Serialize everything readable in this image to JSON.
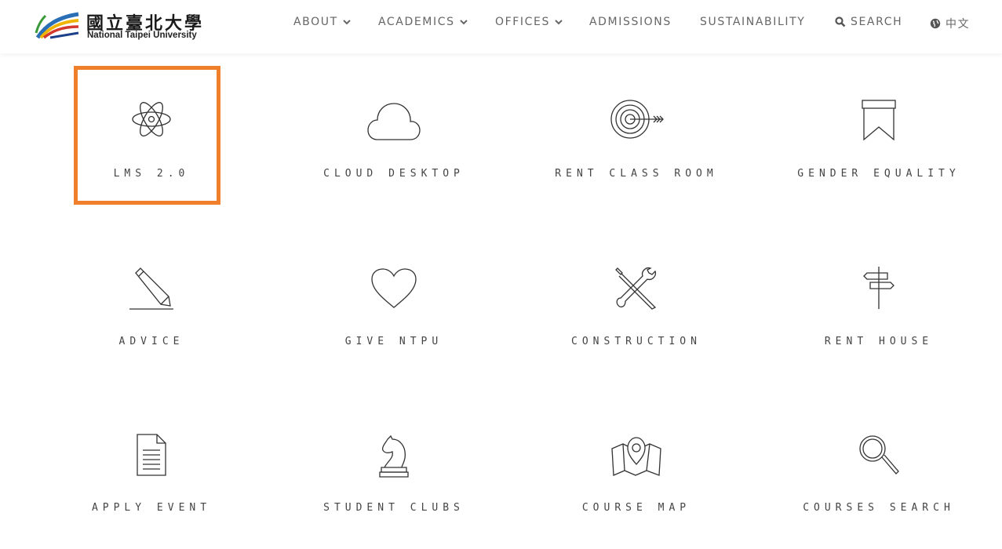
{
  "header": {
    "logo_zh": "國立臺北大學",
    "logo_en": "National Taipei University",
    "nav": {
      "about": "ABOUT",
      "academics": "ACADEMICS",
      "offices": "OFFICES",
      "admissions": "ADMISSIONS",
      "sustainability": "SUSTAINABILITY",
      "search": "SEARCH",
      "language": "中文"
    }
  },
  "tiles": [
    {
      "label": "LMS 2.0",
      "icon": "atom-icon"
    },
    {
      "label": "CLOUD DESKTOP",
      "icon": "cloud-icon"
    },
    {
      "label": "RENT CLASS ROOM",
      "icon": "target-icon"
    },
    {
      "label": "GENDER EQUALITY",
      "icon": "bookmark-icon"
    },
    {
      "label": "ADVICE",
      "icon": "pencil-icon"
    },
    {
      "label": "GIVE NTPU",
      "icon": "heart-icon"
    },
    {
      "label": "CONSTRUCTION",
      "icon": "tools-icon"
    },
    {
      "label": "RENT HOUSE",
      "icon": "signpost-icon"
    },
    {
      "label": "APPLY EVENT",
      "icon": "document-icon"
    },
    {
      "label": "STUDENT CLUBS",
      "icon": "chess-knight-icon"
    },
    {
      "label": "COURSE MAP",
      "icon": "map-icon"
    },
    {
      "label": "COURSES SEARCH",
      "icon": "magnifier-icon"
    }
  ],
  "colors": {
    "highlight": "#ef7f2a",
    "nav_text": "#666666",
    "icon_stroke": "#333333"
  }
}
